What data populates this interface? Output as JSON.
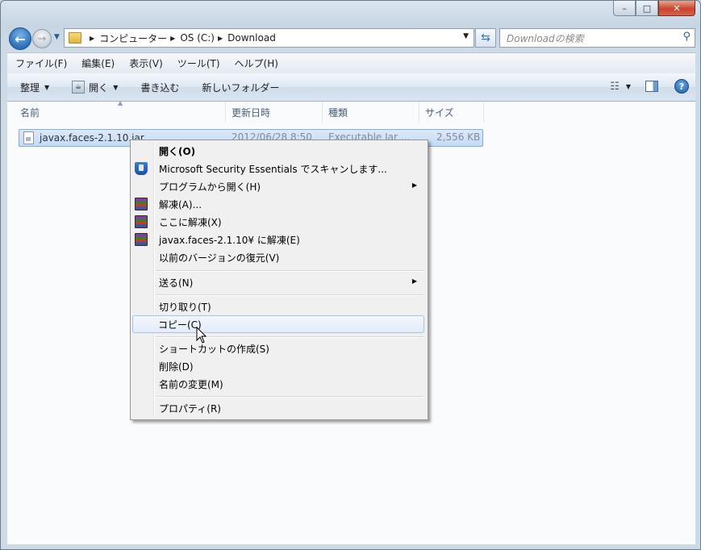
{
  "window": {
    "buttons": {
      "minimize": "–",
      "maximize": "□",
      "close": "✕"
    }
  },
  "navigation": {
    "breadcrumb": [
      "コンピューター",
      "OS (C:)",
      "Download"
    ],
    "search_placeholder": "Downloadの検索"
  },
  "menubar": [
    "ファイル(F)",
    "編集(E)",
    "表示(V)",
    "ツール(T)",
    "ヘルプ(H)"
  ],
  "commandbar": {
    "organize": "整理",
    "open": "開く",
    "burn": "書き込む",
    "new_folder": "新しいフォルダー"
  },
  "columns": [
    "名前",
    "更新日時",
    "種類",
    "サイズ"
  ],
  "files": [
    {
      "name": "javax.faces-2.1.10.jar",
      "modified": "2012/06/28 8:50",
      "type": "Executable Jar ...",
      "size": "2,556 KB",
      "selected": true
    }
  ],
  "context_menu": {
    "items": [
      {
        "label": "開く(O)",
        "bold": true
      },
      {
        "label": "Microsoft Security Essentials でスキャンします...",
        "icon": "security-essentials-icon"
      },
      {
        "label": "プログラムから開く(H)",
        "submenu": true
      },
      {
        "label": "解凍(A)...",
        "icon": "winrar-icon"
      },
      {
        "label": "ここに解凍(X)",
        "icon": "winrar-icon"
      },
      {
        "label": "javax.faces-2.1.10¥ に解凍(E)",
        "icon": "winrar-icon"
      },
      {
        "label": "以前のバージョンの復元(V)"
      },
      {
        "label": "送る(N)",
        "submenu": true
      },
      {
        "label": "切り取り(T)"
      },
      {
        "label": "コピー(C)",
        "highlighted": true
      },
      {
        "label": "ショートカットの作成(S)"
      },
      {
        "label": "削除(D)"
      },
      {
        "label": "名前の変更(M)"
      },
      {
        "label": "プロパティ(R)"
      }
    ]
  }
}
